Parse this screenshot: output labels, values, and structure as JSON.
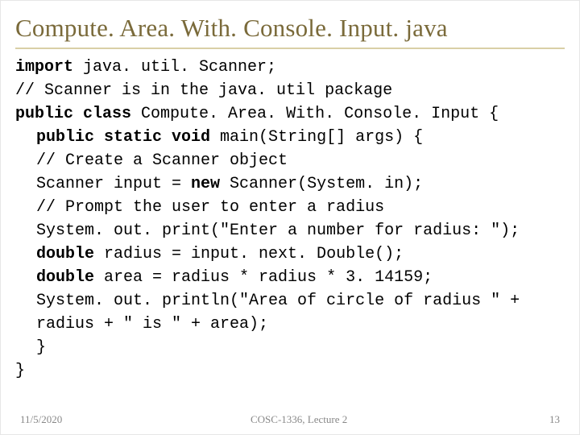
{
  "title": "Compute. Area. With. Console. Input. java",
  "code": {
    "l1a": "import",
    "l1b": " java. util. Scanner;",
    "l2": "// Scanner is in the java. util package",
    "l3a": "public class",
    "l3b": " Compute. Area. With. Console. Input {",
    "l4a": "public static void",
    "l4b": " main(String[] args) {",
    "l5": "// Create a Scanner object",
    "l6a": "Scanner input = ",
    "l6b": "new",
    "l6c": " Scanner(System. in);",
    "l7": "// Prompt the user to enter a radius",
    "l8": "System. out. print(\"Enter a number for radius: \");",
    "l9a": "double",
    "l9b": " radius = input. next. Double();",
    "l10a": "double",
    "l10b": " area = radius * radius * 3. 14159;",
    "l11": "System. out. println(\"Area of circle of radius \" + radius + \" is \" + area);",
    "l12": "}",
    "l13": "}"
  },
  "footer": {
    "date": "11/5/2020",
    "course": "COSC-1336, Lecture 2",
    "page": "13"
  }
}
